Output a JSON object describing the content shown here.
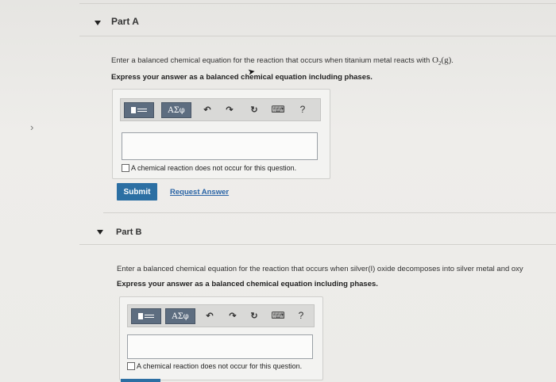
{
  "nav": {
    "left_chevron": "›"
  },
  "partA": {
    "title": "Part A",
    "prompt_text": "Enter a balanced chemical equation for the reaction that occurs when titanium metal reacts with ",
    "formula": "O",
    "formula_sub": "2",
    "formula_phase": "(g)",
    "formula_end": ".",
    "instruction": "Express your answer as a balanced chemical equation including phases.",
    "toolbar": {
      "greek_label": "ΑΣφ",
      "undo_icon": "↶",
      "redo_icon": "↷",
      "reset_icon": "↻",
      "keyboard_icon": "⌨",
      "help_label": "?"
    },
    "input_value": "",
    "checkbox_label": "A chemical reaction does not occur for this question.",
    "submit_label": "Submit",
    "request_answer_label": "Request Answer"
  },
  "partB": {
    "title": "Part B",
    "prompt_text": "Enter a balanced chemical equation for the reaction that occurs when silver(I) oxide decomposes into silver metal and oxy",
    "instruction": "Express your answer as a balanced chemical equation including phases.",
    "toolbar": {
      "greek_label": "ΑΣφ",
      "undo_icon": "↶",
      "redo_icon": "↷",
      "reset_icon": "↻",
      "keyboard_icon": "⌨",
      "help_label": "?"
    },
    "input_value": "",
    "checkbox_label": "A chemical reaction does not occur for this question."
  },
  "colors": {
    "submit_bg": "#2c6fa3",
    "link": "#2a64a6",
    "toolbar_btn": "#5d6d80"
  }
}
